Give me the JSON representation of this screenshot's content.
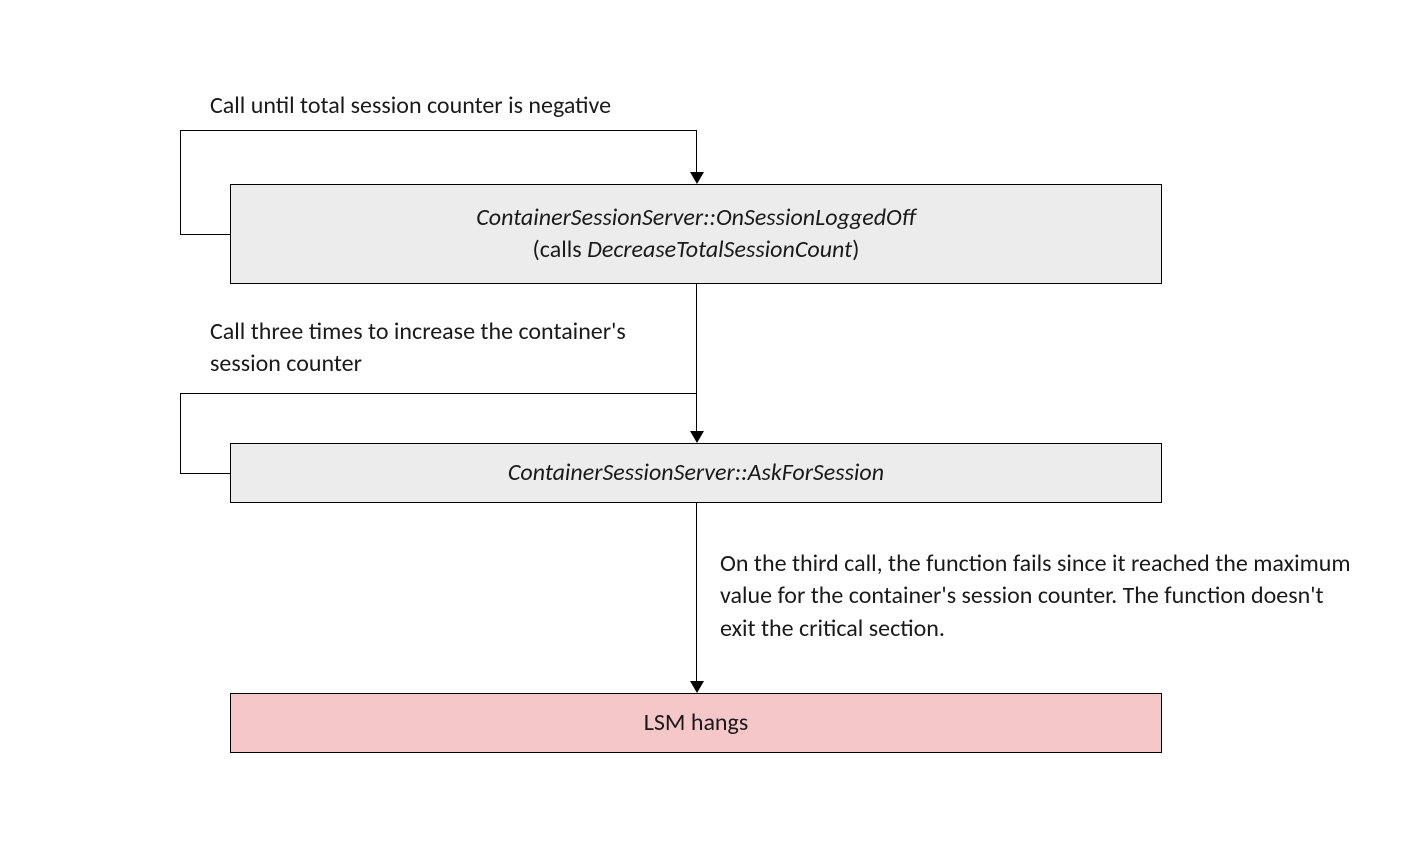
{
  "labels": {
    "top": "Call until total session counter is negative",
    "mid": "Call three times to increase the container's session counter",
    "bottom": "On the third call, the function fails since it reached the maximum value for the container's session counter. The function doesn't exit the critical section."
  },
  "boxes": {
    "b1_line1": "ContainerSessionServer::OnSessionLoggedOff",
    "b1_line2a": "(calls ",
    "b1_line2b": "DecreaseTotalSessionCount",
    "b1_line2c": ")",
    "b2": "ContainerSessionServer::AskForSession",
    "b3": "LSM hangs"
  }
}
